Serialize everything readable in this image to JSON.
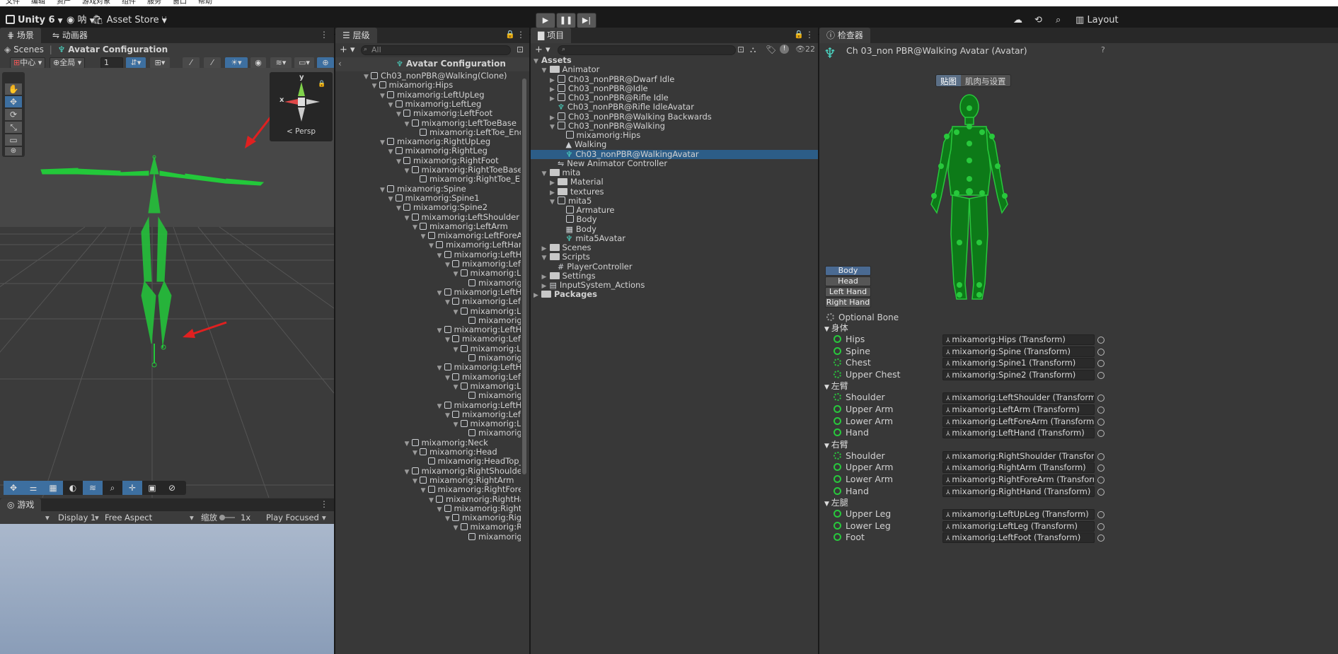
{
  "menubar": {
    "items": [
      "文件",
      "编辑",
      "资产",
      "游戏对象",
      "组件",
      "服务",
      "窗口",
      "帮助"
    ]
  },
  "toolbar": {
    "unity_label": "Unity 6",
    "account": "呐",
    "asset_store": "Asset Store",
    "layout": "Layout"
  },
  "scene_panel": {
    "tabs": [
      "场景",
      "动画器"
    ],
    "breadcrumb_root": "Scenes",
    "breadcrumb_current": "Avatar Configuration",
    "pivot": "中心",
    "space": "全局",
    "snap_value": "1",
    "persp_label": "< Persp",
    "gizmo_x": "x",
    "gizmo_y": "y"
  },
  "game_panel": {
    "tab": "游戏",
    "display": "Display 1",
    "aspect": "Free Aspect",
    "scale_label": "缩放",
    "scale_value": "1x",
    "play_mode": "Play Focused"
  },
  "hierarchy": {
    "tab": "层级",
    "search_placeholder": "All",
    "header": "Avatar Configuration",
    "items": [
      {
        "label": "Ch03_nonPBR@Walking(Clone)",
        "depth": 0,
        "exp": "▼"
      },
      {
        "label": "mixamorig:Hips",
        "depth": 1,
        "exp": "▼"
      },
      {
        "label": "mixamorig:LeftUpLeg",
        "depth": 2,
        "exp": "▼"
      },
      {
        "label": "mixamorig:LeftLeg",
        "depth": 3,
        "exp": "▼"
      },
      {
        "label": "mixamorig:LeftFoot",
        "depth": 4,
        "exp": "▼"
      },
      {
        "label": "mixamorig:LeftToeBase",
        "depth": 5,
        "exp": "▼"
      },
      {
        "label": "mixamorig:LeftToe_End",
        "depth": 6,
        "exp": ""
      },
      {
        "label": "mixamorig:RightUpLeg",
        "depth": 2,
        "exp": "▼"
      },
      {
        "label": "mixamorig:RightLeg",
        "depth": 3,
        "exp": "▼"
      },
      {
        "label": "mixamorig:RightFoot",
        "depth": 4,
        "exp": "▼"
      },
      {
        "label": "mixamorig:RightToeBase",
        "depth": 5,
        "exp": "▼"
      },
      {
        "label": "mixamorig:RightToe_End",
        "depth": 6,
        "exp": ""
      },
      {
        "label": "mixamorig:Spine",
        "depth": 2,
        "exp": "▼"
      },
      {
        "label": "mixamorig:Spine1",
        "depth": 3,
        "exp": "▼"
      },
      {
        "label": "mixamorig:Spine2",
        "depth": 4,
        "exp": "▼"
      },
      {
        "label": "mixamorig:LeftShoulder",
        "depth": 5,
        "exp": "▼"
      },
      {
        "label": "mixamorig:LeftArm",
        "depth": 6,
        "exp": "▼"
      },
      {
        "label": "mixamorig:LeftForeArm",
        "depth": 7,
        "exp": "▼"
      },
      {
        "label": "mixamorig:LeftHand",
        "depth": 8,
        "exp": "▼"
      },
      {
        "label": "mixamorig:LeftHand",
        "depth": 9,
        "exp": "▼"
      },
      {
        "label": "mixamorig:LeftHa",
        "depth": 10,
        "exp": "▼"
      },
      {
        "label": "mixamorig:Left",
        "depth": 11,
        "exp": "▼"
      },
      {
        "label": "mixamorig:L",
        "depth": 12,
        "exp": ""
      },
      {
        "label": "mixamorig:LeftHand",
        "depth": 9,
        "exp": "▼"
      },
      {
        "label": "mixamorig:LeftHa",
        "depth": 10,
        "exp": "▼"
      },
      {
        "label": "mixamorig:Left",
        "depth": 11,
        "exp": "▼"
      },
      {
        "label": "mixamorig:L",
        "depth": 12,
        "exp": ""
      },
      {
        "label": "mixamorig:LeftHand",
        "depth": 9,
        "exp": "▼"
      },
      {
        "label": "mixamorig:LeftHa",
        "depth": 10,
        "exp": "▼"
      },
      {
        "label": "mixamorig:Left",
        "depth": 11,
        "exp": "▼"
      },
      {
        "label": "mixamorig:L",
        "depth": 12,
        "exp": ""
      },
      {
        "label": "mixamorig:LeftHand",
        "depth": 9,
        "exp": "▼"
      },
      {
        "label": "mixamorig:LeftHa",
        "depth": 10,
        "exp": "▼"
      },
      {
        "label": "mixamorig:Left",
        "depth": 11,
        "exp": "▼"
      },
      {
        "label": "mixamorig:L",
        "depth": 12,
        "exp": ""
      },
      {
        "label": "mixamorig:LeftHand",
        "depth": 9,
        "exp": "▼"
      },
      {
        "label": "mixamorig:LeftHa",
        "depth": 10,
        "exp": "▼"
      },
      {
        "label": "mixamorig:Left",
        "depth": 11,
        "exp": "▼"
      },
      {
        "label": "mixamorig:L",
        "depth": 12,
        "exp": ""
      },
      {
        "label": "mixamorig:Neck",
        "depth": 5,
        "exp": "▼"
      },
      {
        "label": "mixamorig:Head",
        "depth": 6,
        "exp": "▼"
      },
      {
        "label": "mixamorig:HeadTop_End",
        "depth": 7,
        "exp": ""
      },
      {
        "label": "mixamorig:RightShoulder",
        "depth": 5,
        "exp": "▼"
      },
      {
        "label": "mixamorig:RightArm",
        "depth": 6,
        "exp": "▼"
      },
      {
        "label": "mixamorig:RightForeArm",
        "depth": 7,
        "exp": "▼"
      },
      {
        "label": "mixamorig:RightHand",
        "depth": 8,
        "exp": "▼"
      },
      {
        "label": "mixamorig:RightHar",
        "depth": 9,
        "exp": "▼"
      },
      {
        "label": "mixamorig:RightH",
        "depth": 10,
        "exp": "▼"
      },
      {
        "label": "mixamorig:Righ",
        "depth": 11,
        "exp": "▼"
      },
      {
        "label": "mixamorig:R",
        "depth": 12,
        "exp": ""
      }
    ]
  },
  "project": {
    "tab": "项目",
    "count": "22",
    "items": [
      {
        "label": "Assets",
        "depth": 0,
        "exp": "▼",
        "icon": "none",
        "bold": true
      },
      {
        "label": "Animator",
        "depth": 1,
        "exp": "▼",
        "icon": "folder-open"
      },
      {
        "label": "Ch03_nonPBR@Dwarf Idle",
        "depth": 2,
        "exp": "▶",
        "icon": "model"
      },
      {
        "label": "Ch03_nonPBR@Idle",
        "depth": 2,
        "exp": "▶",
        "icon": "model"
      },
      {
        "label": "Ch03_nonPBR@Rifle Idle",
        "depth": 2,
        "exp": "▶",
        "icon": "model"
      },
      {
        "label": "Ch03_nonPBR@Rifle IdleAvatar",
        "depth": 2,
        "exp": "",
        "icon": "avatar"
      },
      {
        "label": "Ch03_nonPBR@Walking Backwards",
        "depth": 2,
        "exp": "▶",
        "icon": "model"
      },
      {
        "label": "Ch03_nonPBR@Walking",
        "depth": 2,
        "exp": "▼",
        "icon": "model"
      },
      {
        "label": "mixamorig:Hips",
        "depth": 3,
        "exp": "",
        "icon": "model"
      },
      {
        "label": "Walking",
        "depth": 3,
        "exp": "",
        "icon": "clip"
      },
      {
        "label": "Ch03_nonPBR@WalkingAvatar",
        "depth": 3,
        "exp": "",
        "icon": "avatar",
        "selected": true
      },
      {
        "label": "New Animator Controller",
        "depth": 2,
        "exp": "",
        "icon": "controller"
      },
      {
        "label": "mita",
        "depth": 1,
        "exp": "▼",
        "icon": "folder-open"
      },
      {
        "label": "Material",
        "depth": 2,
        "exp": "▶",
        "icon": "folder"
      },
      {
        "label": "textures",
        "depth": 2,
        "exp": "▶",
        "icon": "folder"
      },
      {
        "label": "mita5",
        "depth": 2,
        "exp": "▼",
        "icon": "model"
      },
      {
        "label": "Armature",
        "depth": 3,
        "exp": "",
        "icon": "model"
      },
      {
        "label": "Body",
        "depth": 3,
        "exp": "",
        "icon": "model"
      },
      {
        "label": "Body",
        "depth": 3,
        "exp": "",
        "icon": "mesh"
      },
      {
        "label": "mita5Avatar",
        "depth": 3,
        "exp": "",
        "icon": "avatar"
      },
      {
        "label": "Scenes",
        "depth": 1,
        "exp": "▶",
        "icon": "folder"
      },
      {
        "label": "Scripts",
        "depth": 1,
        "exp": "▼",
        "icon": "folder-open"
      },
      {
        "label": "PlayerController",
        "depth": 2,
        "exp": "",
        "icon": "script"
      },
      {
        "label": "Settings",
        "depth": 1,
        "exp": "▶",
        "icon": "folder"
      },
      {
        "label": "InputSystem_Actions",
        "depth": 1,
        "exp": "▶",
        "icon": "input"
      },
      {
        "label": "Packages",
        "depth": 0,
        "exp": "▶",
        "icon": "folder",
        "bold": true
      }
    ]
  },
  "inspector": {
    "tab": "检查器",
    "title": "Ch 03_non PBR@Walking Avatar (Avatar)",
    "mapping_tab": "贴图",
    "muscles_tab": "肌肉与设置",
    "body_buttons": [
      "Body",
      "Head",
      "Left Hand",
      "Right Hand"
    ],
    "optional_bone": "Optional Bone",
    "sections": [
      {
        "title": "身体",
        "bones": [
          {
            "name": "Hips",
            "value": "mixamorig:Hips (Transform)",
            "optional": false
          },
          {
            "name": "Spine",
            "value": "mixamorig:Spine (Transform)",
            "optional": false
          },
          {
            "name": "Chest",
            "value": "mixamorig:Spine1 (Transform)",
            "optional": true
          },
          {
            "name": "Upper Chest",
            "value": "mixamorig:Spine2 (Transform)",
            "optional": true
          }
        ]
      },
      {
        "title": "左臂",
        "bones": [
          {
            "name": "Shoulder",
            "value": "mixamorig:LeftShoulder (Transform)",
            "optional": true
          },
          {
            "name": "Upper Arm",
            "value": "mixamorig:LeftArm (Transform)",
            "optional": false
          },
          {
            "name": "Lower Arm",
            "value": "mixamorig:LeftForeArm (Transform)",
            "optional": false
          },
          {
            "name": "Hand",
            "value": "mixamorig:LeftHand (Transform)",
            "optional": false
          }
        ]
      },
      {
        "title": "右臂",
        "bones": [
          {
            "name": "Shoulder",
            "value": "mixamorig:RightShoulder (Transform)",
            "optional": true
          },
          {
            "name": "Upper Arm",
            "value": "mixamorig:RightArm (Transform)",
            "optional": false
          },
          {
            "name": "Lower Arm",
            "value": "mixamorig:RightForeArm (Transform)",
            "optional": false
          },
          {
            "name": "Hand",
            "value": "mixamorig:RightHand (Transform)",
            "optional": false
          }
        ]
      },
      {
        "title": "左腿",
        "bones": [
          {
            "name": "Upper Leg",
            "value": "mixamorig:LeftUpLeg (Transform)",
            "optional": false
          },
          {
            "name": "Lower Leg",
            "value": "mixamorig:LeftLeg (Transform)",
            "optional": false
          },
          {
            "name": "Foot",
            "value": "mixamorig:LeftFoot (Transform)",
            "optional": false
          }
        ]
      }
    ]
  },
  "colors": {
    "bone_green": "#23c83a",
    "selection": "#2c5d87",
    "panel": "#383838",
    "red_arrow": "#e02020"
  }
}
